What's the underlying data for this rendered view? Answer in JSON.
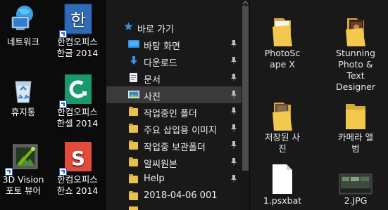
{
  "desktop": {
    "icons": [
      {
        "label": "네트워크",
        "label2": "",
        "icon": "network-icon"
      },
      {
        "label": "한컴오피스",
        "label2": "한글 2014",
        "icon": "hangul-2014-icon"
      },
      {
        "label": "휴지통",
        "label2": "",
        "icon": "recycle-bin-icon"
      },
      {
        "label": "한컴오피스",
        "label2": "한셀 2014",
        "icon": "hancell-2014-icon"
      },
      {
        "label": "3D Vision",
        "label2": "포토 뷰어",
        "icon": "3d-vision-photo-viewer-icon"
      },
      {
        "label": "한컴오피스",
        "label2": "한쇼 2014",
        "icon": "hanshow-2014-icon"
      }
    ]
  },
  "nav": {
    "header": "바로 가기",
    "items": [
      {
        "label": "바탕 화면",
        "icon": "desktop-folder-icon",
        "pinned": true
      },
      {
        "label": "다운로드",
        "icon": "download-arrow-icon",
        "pinned": true
      },
      {
        "label": "문서",
        "icon": "documents-icon",
        "pinned": true
      },
      {
        "label": "사진",
        "icon": "pictures-icon",
        "pinned": true,
        "selected": true
      },
      {
        "label": "작업중인 폴더",
        "icon": "folder-icon",
        "pinned": true
      },
      {
        "label": "주요 삽입용 이미지",
        "icon": "folder-icon",
        "pinned": true
      },
      {
        "label": "작업중 보관폴더",
        "icon": "folder-icon",
        "pinned": true
      },
      {
        "label": "알씨원본",
        "icon": "folder-icon",
        "pinned": true
      },
      {
        "label": "Help",
        "icon": "folder-icon",
        "pinned": true
      },
      {
        "label": "2018-04-06 001",
        "icon": "folder-icon",
        "pinned": false
      }
    ]
  },
  "content": {
    "items": [
      {
        "label": "PhotoSc",
        "label2": "ape X",
        "label3": "",
        "icon": "folder-icon"
      },
      {
        "label": "Stunning",
        "label2": "Photo &",
        "label3": "Text",
        "label4": "Designer",
        "icon": "app-folder-icon"
      },
      {
        "label": "저장된 사",
        "label2": "진",
        "icon": "folder-icon"
      },
      {
        "label": "카메라 앨",
        "label2": "범",
        "icon": "folder-icon"
      },
      {
        "label": "1.psxbat",
        "label2": "",
        "icon": "file-icon"
      },
      {
        "label": "2.JPG",
        "label2": "",
        "icon": "image-thumbnail-icon"
      }
    ]
  },
  "colors": {
    "accent": "#3b8ee5",
    "folder": "#e8c04a",
    "selected_row": "#3a3a3a"
  }
}
